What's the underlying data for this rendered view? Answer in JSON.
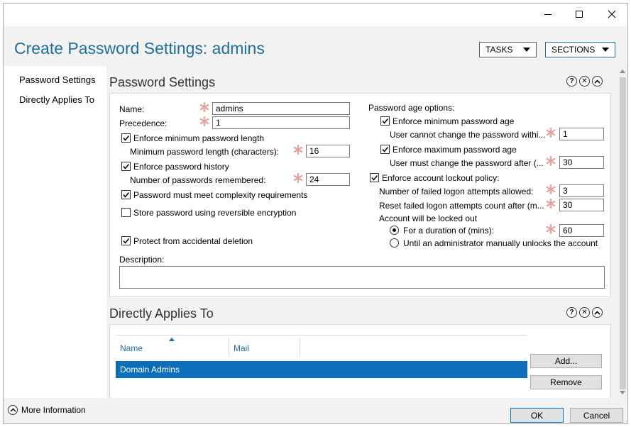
{
  "window": {
    "title": "Create Password Settings: admins"
  },
  "header": {
    "tasks_label": "TASKS",
    "sections_label": "SECTIONS"
  },
  "nav": {
    "items": [
      {
        "label": "Password Settings"
      },
      {
        "label": "Directly Applies To"
      }
    ]
  },
  "password_settings": {
    "title": "Password Settings",
    "name_label": "Name:",
    "name_value": "admins",
    "precedence_label": "Precedence:",
    "precedence_value": "1",
    "enforce_min_length_label": "Enforce minimum password length",
    "enforce_min_length_checked": true,
    "min_length_label": "Minimum password length (characters):",
    "min_length_value": "16",
    "enforce_history_label": "Enforce password history",
    "enforce_history_checked": true,
    "history_label": "Number of passwords remembered:",
    "history_value": "24",
    "complexity_label": "Password must meet complexity requirements",
    "complexity_checked": true,
    "reversible_label": "Store password using reversible encryption",
    "reversible_checked": false,
    "protect_label": "Protect from accidental deletion",
    "protect_checked": true,
    "description_label": "Description:",
    "age_options_label": "Password age options:",
    "enforce_min_age_label": "Enforce minimum password age",
    "enforce_min_age_checked": true,
    "min_age_label": "User cannot change the password withi...",
    "min_age_value": "1",
    "enforce_max_age_label": "Enforce maximum password age",
    "enforce_max_age_checked": true,
    "max_age_label": "User must change the password after (...",
    "max_age_value": "30",
    "lockout_label": "Enforce account lockout policy:",
    "lockout_checked": true,
    "failed_attempts_label": "Number of failed logon attempts allowed:",
    "failed_attempts_value": "3",
    "reset_count_label": "Reset failed logon attempts count after (m...",
    "reset_count_value": "30",
    "locked_out_label": "Account will be locked out",
    "duration_label": "For a duration of (mins):",
    "duration_value": "60",
    "duration_selected": true,
    "manual_unlock_label": "Until an administrator manually unlocks the account",
    "manual_unlock_selected": false
  },
  "directly_applies": {
    "title": "Directly Applies To",
    "columns": [
      "Name",
      "Mail"
    ],
    "rows": [
      {
        "name": "Domain Admins",
        "mail": ""
      }
    ],
    "add_label": "Add...",
    "remove_label": "Remove"
  },
  "footer": {
    "more_info_label": "More Information",
    "ok_label": "OK",
    "cancel_label": "Cancel"
  },
  "colors": {
    "accent": "#1e6e9a",
    "selection": "#0a6fb8",
    "required": "#e8a0a0",
    "panel_bg": "#f2f2f2"
  }
}
